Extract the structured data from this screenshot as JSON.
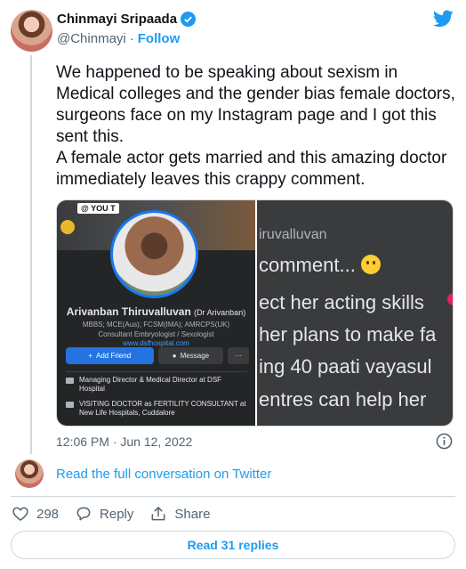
{
  "author": {
    "display_name": "Chinmayi Sripaada",
    "handle": "@Chinmayi",
    "separator": "·",
    "follow_label": "Follow",
    "verified": true
  },
  "tweet": {
    "text": "We happened to be speaking about sexism in Medical colleges and the gender bias female doctors, surgeons face on my Instagram page and I got this sent this.\nA female actor gets married and this amazing doctor immediately leaves this crappy comment.",
    "timestamp": "12:06 PM · Jun 12, 2022"
  },
  "media": {
    "left": {
      "tag": "@ YOU T",
      "name": "Arivanban Thiruvalluvan",
      "name_sub": "(Dr Arivanban)",
      "credentials": "MBBS; MCE(Aus); FCSM(IMA); AMRCPS(UK)\nConsultant Embryologist / Sexologist",
      "website": "www.dsfhospital.com",
      "add_friend_label": "Add Friend",
      "message_label": "Message",
      "more_label": "···",
      "info_1": "Managing Director & Medical Director at DSF Hospital",
      "info_2": "VISITING DOCTOR as FERTILITY CONSULTANT at New Life Hospitals, Cuddalore"
    },
    "right": {
      "line_1": "iruvalluvan",
      "line_2": "comment...",
      "line_3": "ect her acting skills",
      "line_4": "her plans to make fa",
      "line_5": "ing 40 paati vayasul",
      "line_6": "entres can help her"
    }
  },
  "read_conversation_label": "Read the full conversation on Twitter",
  "actions": {
    "like_count": "298",
    "reply_label": "Reply",
    "share_label": "Share"
  },
  "read_replies_label": "Read 31 replies",
  "colors": {
    "accent": "#1d9bf0",
    "text": "#0f1419",
    "secondary": "#536471",
    "border": "#cfd9de"
  }
}
